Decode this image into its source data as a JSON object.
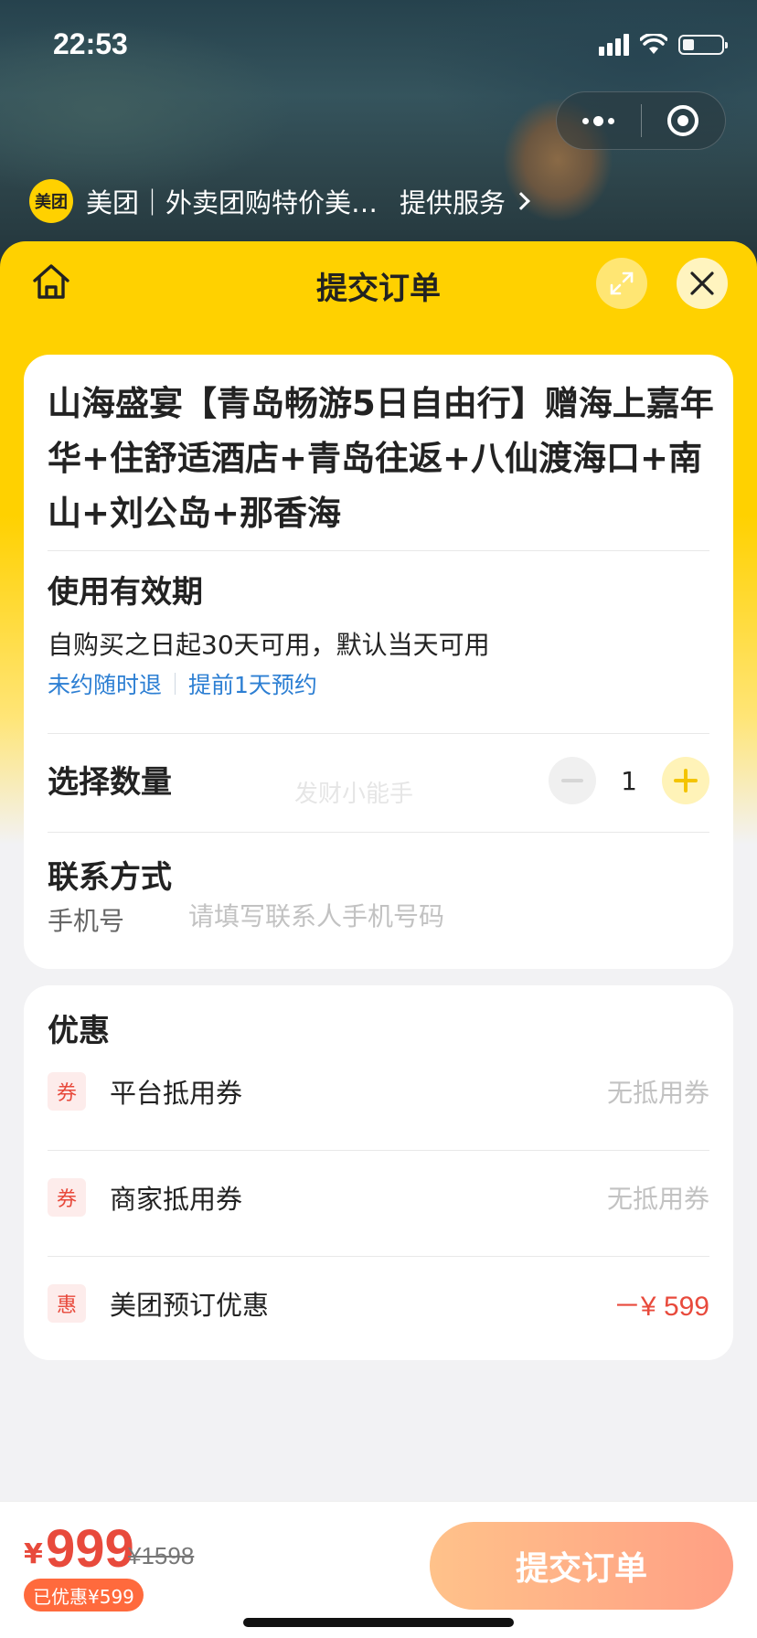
{
  "status_bar": {
    "time": "22:53",
    "battery_level": 0.2
  },
  "capsule": {
    "more_icon": "more-dots-icon",
    "close_icon": "target-close-icon"
  },
  "provider": {
    "logo_text": "美团",
    "name": "美团｜外卖团购特价美…",
    "service_label": "提供服务"
  },
  "sheet": {
    "title": "提交订单",
    "icons": [
      "home-icon",
      "expand-icon",
      "close-icon"
    ]
  },
  "product": {
    "title": "山海盛宴【青岛畅游5日自由行】赠海上嘉年华+住舒适酒店+青岛往返+八仙渡海口+南山+刘公岛+那香海"
  },
  "validity": {
    "label": "使用有效期",
    "text": "自购买之日起30天可用，默认当天可用",
    "tags": [
      "未约随时退",
      "提前1天预约"
    ]
  },
  "quantity": {
    "label": "选择数量",
    "value": "1",
    "watermark": "发财小能手"
  },
  "contact": {
    "label": "联系方式",
    "phone_label": "手机号",
    "phone_placeholder": "请填写联系人手机号码",
    "phone_value": ""
  },
  "discounts": {
    "label": "优惠",
    "rows": [
      {
        "badge": "券",
        "name": "平台抵用券",
        "value": "无抵用券"
      },
      {
        "badge": "券",
        "name": "商家抵用券",
        "value": "无抵用券"
      },
      {
        "badge": "惠",
        "name": "美团预订优惠",
        "value": "－¥ 599"
      }
    ]
  },
  "footer": {
    "currency": "¥",
    "price": "999",
    "original_price": "¥1598",
    "saved": "已优惠¥599",
    "submit_label": "提交订单"
  },
  "colors": {
    "brand_yellow": "#ffd100",
    "price_red": "#e84a3c",
    "link_blue": "#2d7fd3",
    "submit_gradient": [
      "#ffc28a",
      "#ff9f84"
    ]
  }
}
